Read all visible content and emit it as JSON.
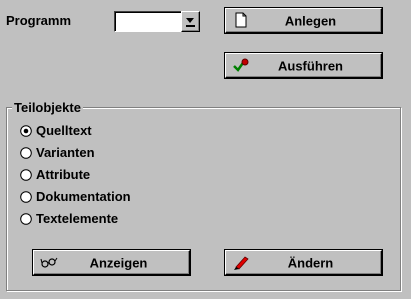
{
  "program": {
    "label": "Programm",
    "value": ""
  },
  "buttons": {
    "anlegen": "Anlegen",
    "ausfuehren": "Ausführen",
    "anzeigen": "Anzeigen",
    "aendern": "Ändern"
  },
  "group": {
    "title": "Teilobjekte",
    "options": [
      {
        "label": "Quelltext",
        "selected": true
      },
      {
        "label": "Varianten",
        "selected": false
      },
      {
        "label": "Attribute",
        "selected": false
      },
      {
        "label": "Dokumentation",
        "selected": false
      },
      {
        "label": "Textelemente",
        "selected": false
      }
    ]
  },
  "icons": {
    "anlegen": "new-document-icon",
    "ausfuehren": "execute-check-icon",
    "anzeigen": "glasses-icon",
    "aendern": "pencil-icon",
    "combo": "dropdown-arrow-icon"
  },
  "colors": {
    "background": "#c0c0c0",
    "check_green": "#008000",
    "execute_red": "#c00000",
    "pencil_red": "#e00000"
  }
}
